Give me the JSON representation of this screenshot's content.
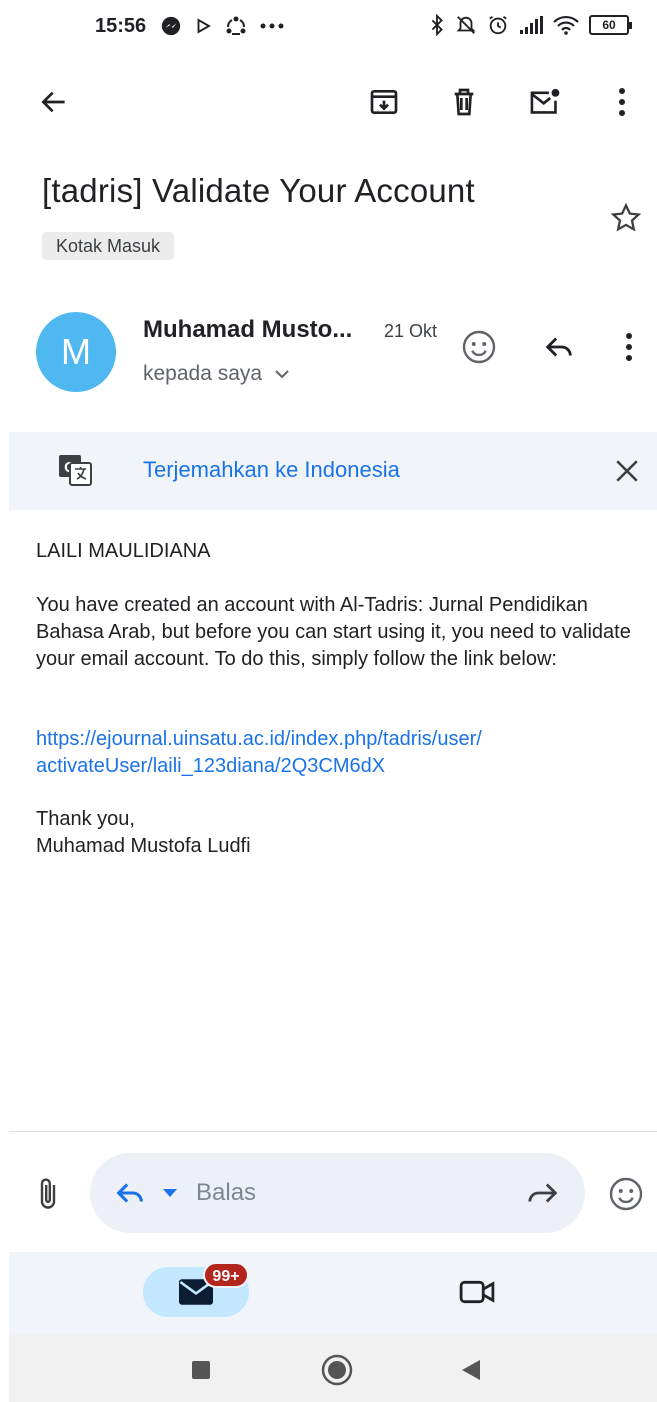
{
  "status_bar": {
    "time": "15:56",
    "battery": "60"
  },
  "email": {
    "subject": "[tadris] Validate Your Account",
    "label": "Kotak Masuk",
    "sender": {
      "initial": "M",
      "name": "Muhamad Musto...",
      "date": "21 Okt",
      "recipient": "kepada saya"
    },
    "translate": {
      "link": "Terjemahkan ke Indonesia"
    },
    "body": {
      "greeting": "LAILI MAULIDIANA",
      "paragraph": "You have created an account with Al-Tadris: Jurnal Pendidikan Bahasa Arab, but before you can start using it, you need to validate your email account. To do this, simply follow the link below:",
      "link_line1": "https://ejournal.uinsatu.ac.id/index.php/tadris/user/",
      "link_line2": "activateUser/laili_123diana/2Q3CM6dX",
      "signoff": "Thank you,",
      "signature": "Muhamad Mustofa Ludfi"
    }
  },
  "reply_bar": {
    "placeholder": "Balas"
  },
  "bottom_nav": {
    "mail_badge": "99+"
  },
  "colors": {
    "accent": "#1a73e8",
    "avatar": "#4fb8f0",
    "badge": "#b3261e"
  }
}
